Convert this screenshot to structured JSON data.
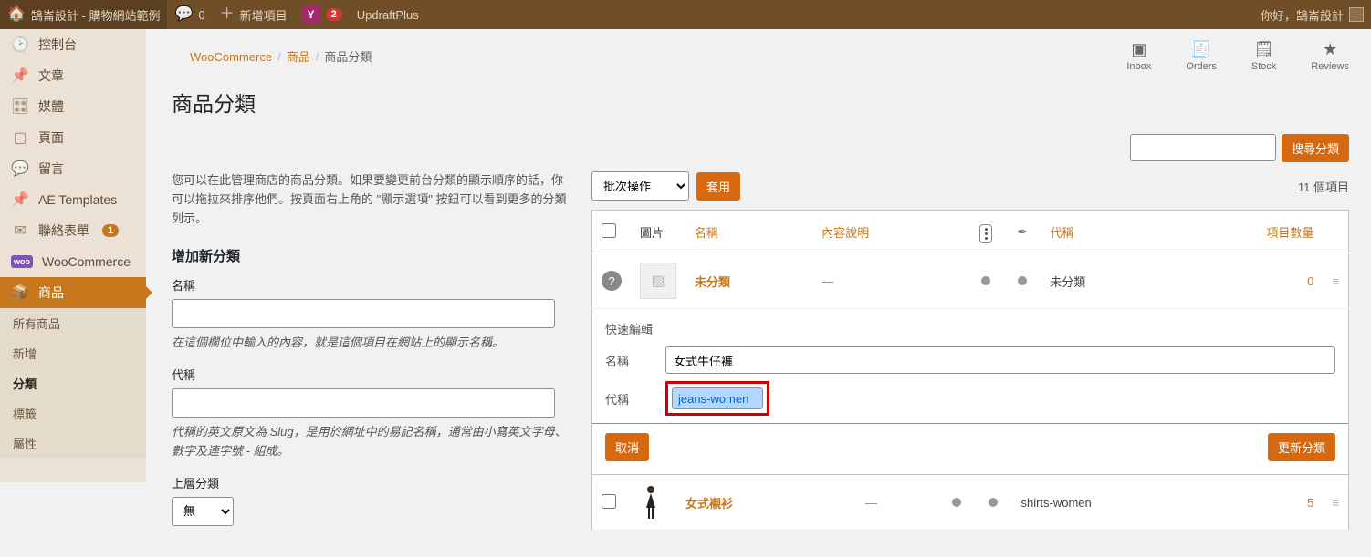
{
  "toolbar": {
    "site_title": "鵠崙設計 - 購物網站範例",
    "comments": "0",
    "new_item": "新增項目",
    "yoast_count": "2",
    "updraft": "UpdraftPlus",
    "howdy": "你好，鵠崙設計"
  },
  "sidebar": {
    "items": [
      {
        "icon": "⏱",
        "label": "控制台"
      },
      {
        "icon": "📌",
        "label": "文章"
      },
      {
        "icon": "🎛",
        "label": "媒體"
      },
      {
        "icon": "📄",
        "label": "頁面"
      },
      {
        "icon": "💬",
        "label": "留言"
      },
      {
        "icon": "📌",
        "label": "AE Templates"
      },
      {
        "icon": "✉",
        "label": "聯絡表單",
        "badge": "1"
      },
      {
        "icon": "woo",
        "label": "WooCommerce"
      },
      {
        "icon": "📦",
        "label": "商品",
        "active": true
      }
    ],
    "sub": [
      "所有商品",
      "新增",
      "分類",
      "標籤",
      "屬性"
    ],
    "sub_selected": "分類"
  },
  "topicons": [
    {
      "icon": "✉",
      "label": "Inbox"
    },
    {
      "icon": "🧾",
      "label": "Orders"
    },
    {
      "icon": "🗒",
      "label": "Stock"
    },
    {
      "icon": "★",
      "label": "Reviews"
    }
  ],
  "breadcrumb": {
    "a": "WooCommerce",
    "b": "商品",
    "c": "商品分類"
  },
  "page_title": "商品分類",
  "intro": "您可以在此管理商店的商品分類。如果要變更前台分類的顯示順序的話，你可以拖拉來排序他們。按頁面右上角的 \"顯示選項\" 按鈕可以看到更多的分類列示。",
  "add_new_title": "增加新分類",
  "name": {
    "label": "名稱",
    "help": "在這個欄位中輸入的內容，就是這個項目在網站上的顯示名稱。"
  },
  "slug": {
    "label": "代稱",
    "help": "代稱的英文原文為 Slug，是用於網址中的易記名稱，通常由小寫英文字母、數字及連字號 - 組成。"
  },
  "parent": {
    "label": "上層分類",
    "value": "無"
  },
  "search_btn": "搜尋分類",
  "bulk": {
    "label": "批次操作",
    "apply": "套用"
  },
  "count_text": "11 個項目",
  "th": {
    "img": "圖片",
    "name": "名稱",
    "desc": "內容說明",
    "slug": "代稱",
    "count": "項目數量"
  },
  "rows": [
    {
      "name": "未分類",
      "desc": "—",
      "slug": "未分類",
      "count": "0",
      "q": true
    },
    {
      "name": "女式襯衫",
      "desc": "—",
      "slug": "shirts-women",
      "count": "5",
      "woman": true
    }
  ],
  "quickedit": {
    "title": "快速編輯",
    "name_lbl": "名稱",
    "name_val": "女式牛仔褲",
    "slug_lbl": "代稱",
    "slug_val": "jeans-women",
    "cancel": "取消",
    "update": "更新分類"
  }
}
